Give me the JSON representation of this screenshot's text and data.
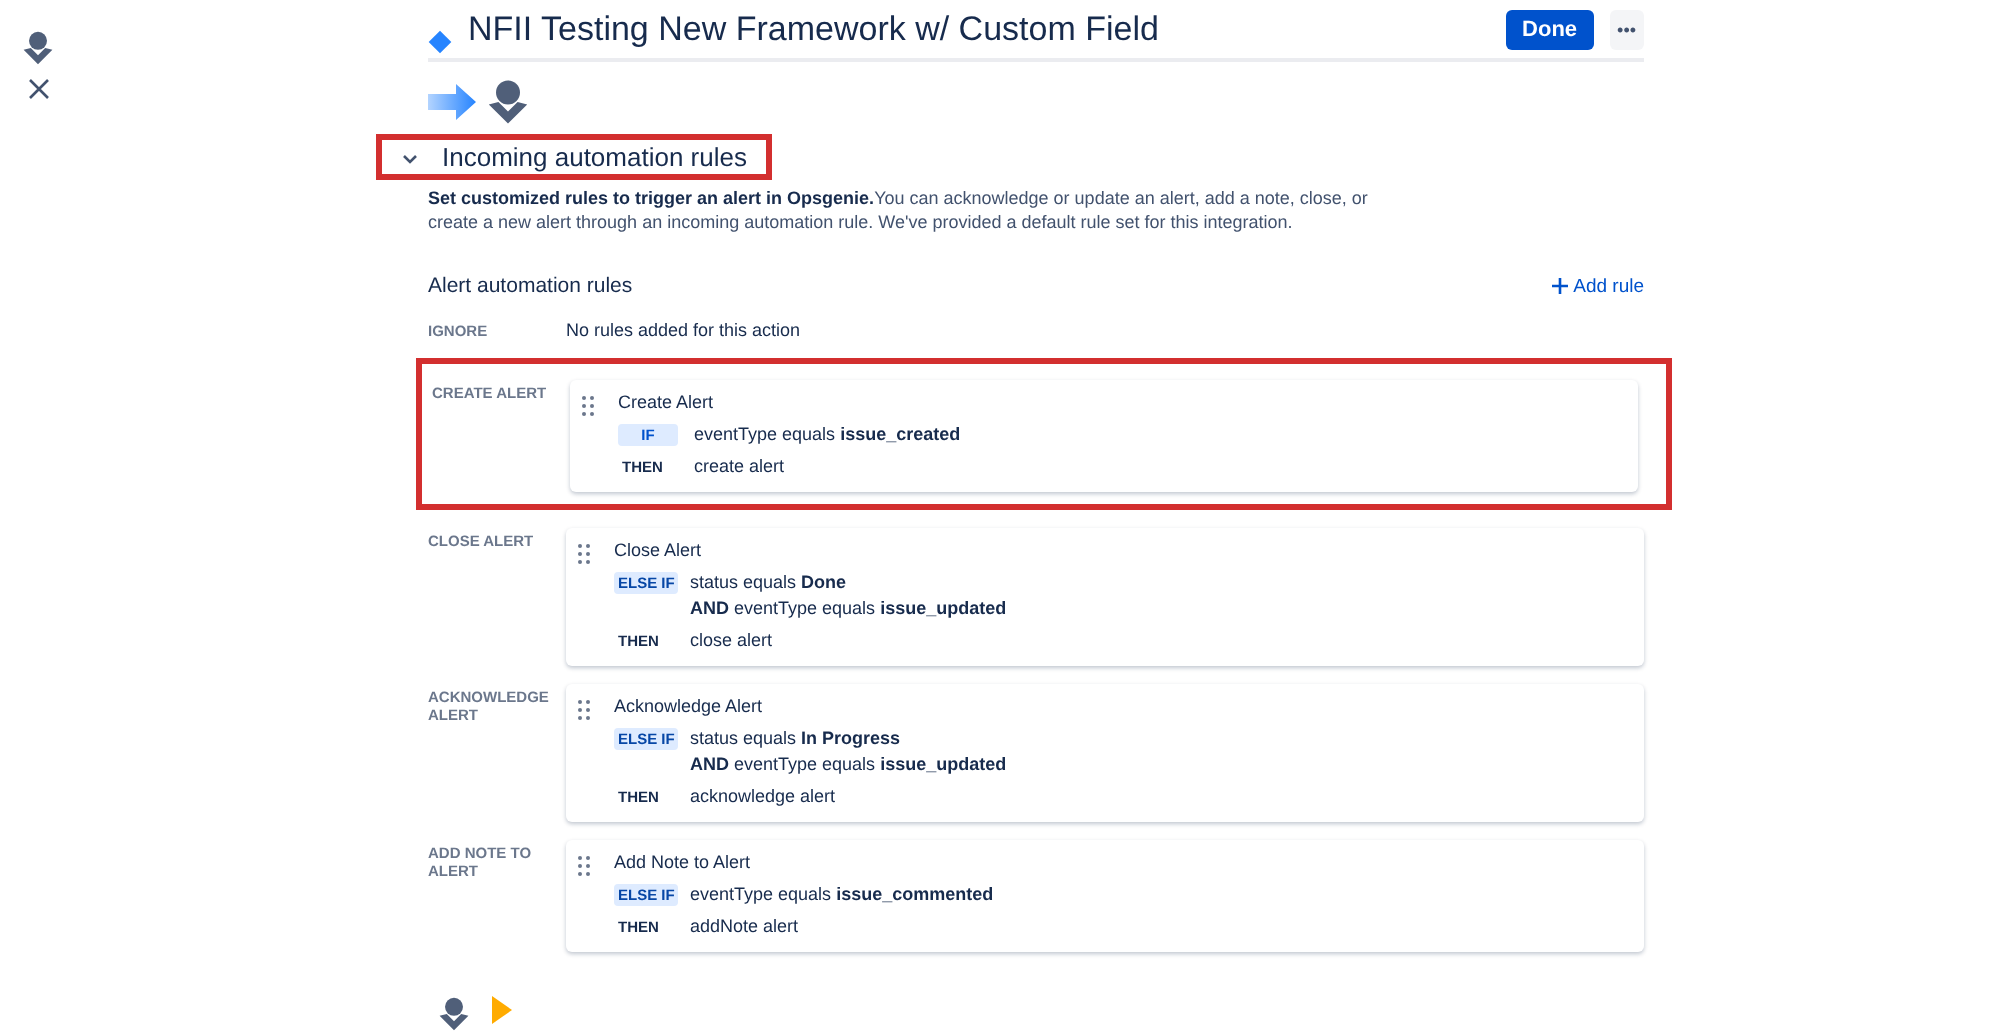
{
  "header": {
    "title": "NFII Testing New Framework w/ Custom Field",
    "done_button": "Done",
    "more_button": "•••"
  },
  "section": {
    "title": "Incoming automation rules",
    "expanded": true,
    "highlighted": true,
    "description": "**Set customized rules to trigger an alert in Opsgenie.**You can acknowledge or update an alert, add a note, close, or create a new alert through an incoming automation rule. We've provided a default rule set for this integration."
  },
  "rules_heading": "Alert automation rules",
  "add_rule": "Add rule",
  "actions": [
    {
      "label": "IGNORE",
      "empty_text": "No rules added for this action"
    },
    {
      "label": "CREATE ALERT",
      "highlighted": true,
      "rule": {
        "name": "Create Alert",
        "kind": "if",
        "badge": "IF",
        "conditions": [
          "eventType equals **issue_created**"
        ],
        "then_label": "THEN",
        "then": "create alert"
      }
    },
    {
      "label": "CLOSE ALERT",
      "highlighted": false,
      "rule": {
        "name": "Close Alert",
        "kind": "else_if",
        "badge": "ELSE IF",
        "conditions": [
          "status equals **Done**",
          "**AND** eventType equals **issue_updated**"
        ],
        "then_label": "THEN",
        "then": "close alert"
      }
    },
    {
      "label": "ACKNOWLEDGE ALERT",
      "highlighted": false,
      "rule": {
        "name": "Acknowledge Alert",
        "kind": "else_if",
        "badge": "ELSE IF",
        "conditions": [
          "status equals **In Progress**",
          "**AND** eventType equals **issue_updated**"
        ],
        "then_label": "THEN",
        "then": "acknowledge alert"
      }
    },
    {
      "label": "ADD NOTE TO ALERT",
      "highlighted": false,
      "rule": {
        "name": "Add Note to Alert",
        "kind": "else_if",
        "badge": "ELSE IF",
        "conditions": [
          "eventType equals **issue_commented**"
        ],
        "then_label": "THEN",
        "then": "addNote alert"
      }
    }
  ]
}
